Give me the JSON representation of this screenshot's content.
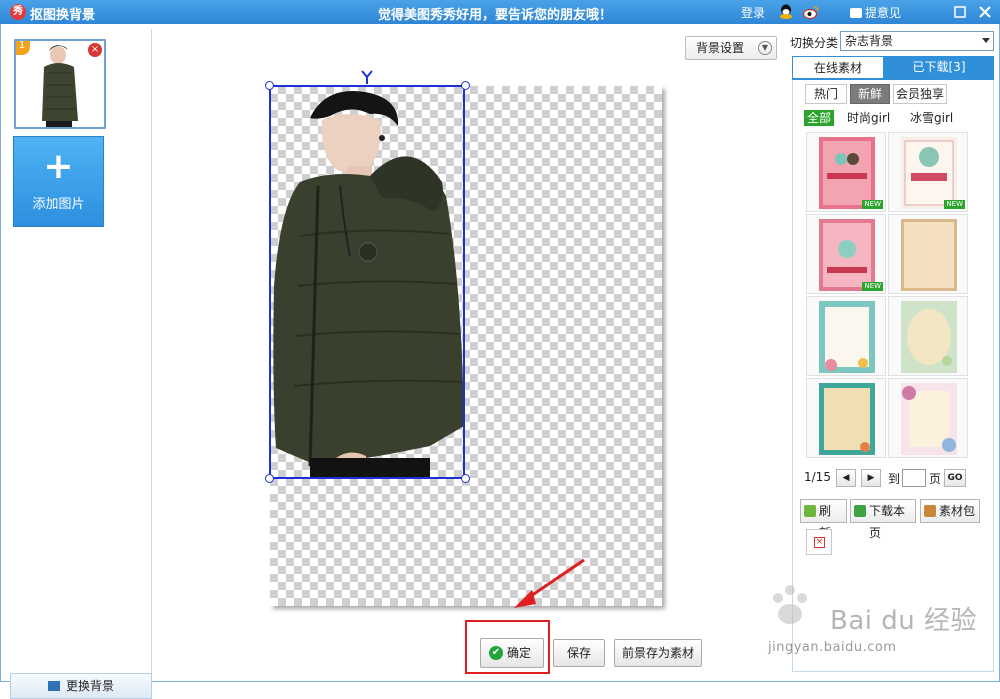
{
  "window": {
    "app_icon_text": "秀",
    "title": "抠图换背景",
    "slogan": "觉得美图秀秀好用，要告诉您的朋友哦！",
    "login": "登录",
    "feedback": "提意见"
  },
  "left_panel": {
    "thumb_index": "1",
    "add_image_label": "添加图片",
    "change_bg_label": "更换背景"
  },
  "canvas": {
    "bg_settings_label": "背景设置",
    "confirm_label": "确定",
    "save_label": "保存",
    "save_foreground_label": "前景存为素材"
  },
  "right_panel": {
    "category_label": "切换分类",
    "category_value": "杂志背景",
    "tabs": [
      "在线素材",
      "已下载[3]"
    ],
    "subtabs": [
      "热门",
      "新鲜",
      "会员独享"
    ],
    "filters": [
      "全部",
      "时尚girl",
      "冰雪girl"
    ],
    "new_badge": "NEW",
    "pager": {
      "current": "1/15",
      "to": "到",
      "page": "页",
      "go": "GO",
      "input_value": ""
    },
    "tools": [
      "刷新",
      "下载本页",
      "素材包"
    ]
  },
  "watermark": {
    "brand": "Bai du 经验",
    "url": "jingyan.baidu.com"
  },
  "colors": {
    "titlebar": "#2f86d6",
    "accent_blue": "#2f8fd8",
    "selection": "#1f2fd9",
    "highlight_red": "#e02020",
    "new_green": "#2ba42b"
  }
}
